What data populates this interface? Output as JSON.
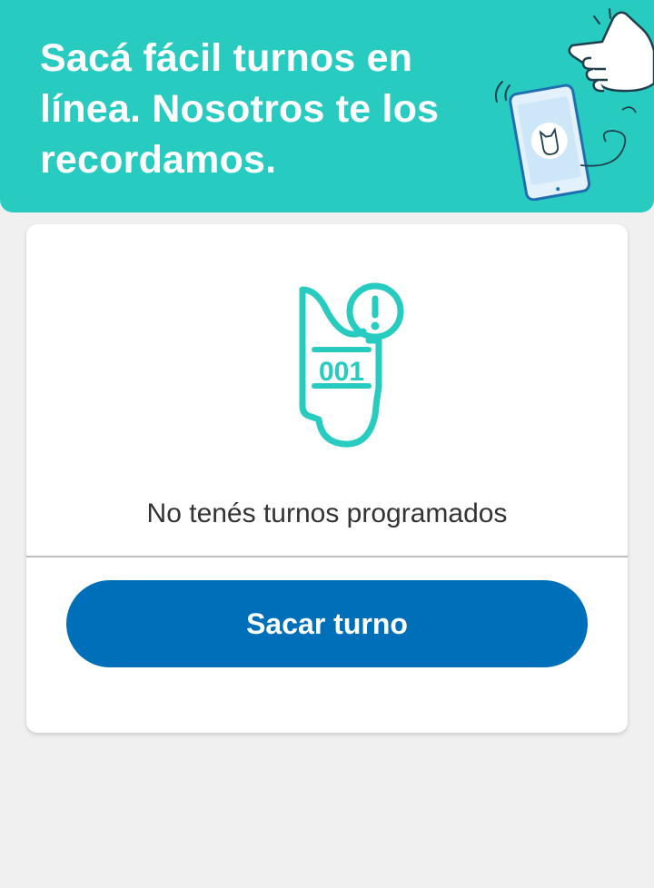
{
  "banner": {
    "title": "Sacá fácil turnos en línea. Nosotros te los recordamos.",
    "background_color": "#28cbc0",
    "illustration": "hand-pointing-at-phone-with-ticket-illustration"
  },
  "appointments": {
    "empty_icon": "ticket-alert-icon",
    "ticket_number": "001",
    "empty_message": "No tenés turnos programados",
    "accent_color": "#28cbc0"
  },
  "actions": {
    "primary_label": "Sacar turno",
    "primary_color": "#006fb9"
  }
}
